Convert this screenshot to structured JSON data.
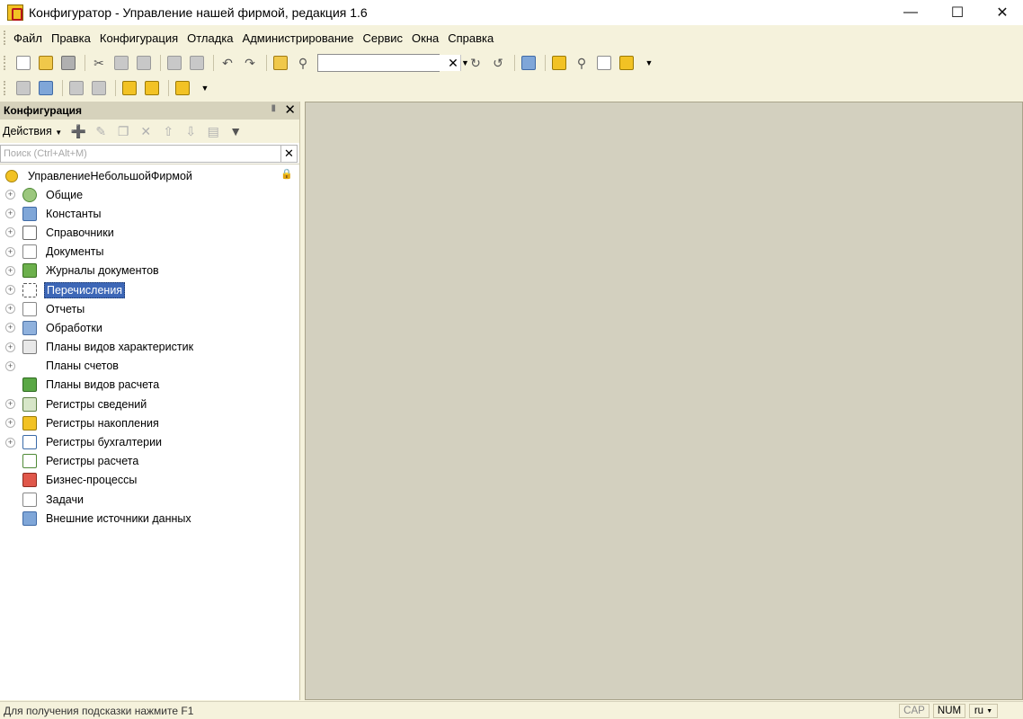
{
  "window": {
    "title": "Конфигуратор - Управление нашей фирмой, редакция 1.6"
  },
  "menu": [
    "Файл",
    "Правка",
    "Конфигурация",
    "Отладка",
    "Администрирование",
    "Сервис",
    "Окна",
    "Справка"
  ],
  "panel": {
    "title": "Конфигурация",
    "actions_label": "Действия",
    "search_placeholder": "Поиск (Ctrl+Alt+M)"
  },
  "tree": {
    "root": "УправлениеНебольшойФирмой",
    "items": [
      {
        "label": "Общие",
        "expandable": true,
        "icon": "common-icon"
      },
      {
        "label": "Константы",
        "expandable": true,
        "icon": "constants-icon"
      },
      {
        "label": "Справочники",
        "expandable": true,
        "icon": "catalogs-icon"
      },
      {
        "label": "Документы",
        "expandable": true,
        "icon": "documents-icon"
      },
      {
        "label": "Журналы документов",
        "expandable": true,
        "icon": "journals-icon"
      },
      {
        "label": "Перечисления",
        "expandable": true,
        "icon": "enums-icon",
        "selected": true
      },
      {
        "label": "Отчеты",
        "expandable": true,
        "icon": "reports-icon"
      },
      {
        "label": "Обработки",
        "expandable": true,
        "icon": "processing-icon"
      },
      {
        "label": "Планы видов характеристик",
        "expandable": true,
        "icon": "characteristic-plans-icon"
      },
      {
        "label": "Планы счетов",
        "expandable": true,
        "icon": "chart-of-accounts-icon"
      },
      {
        "label": "Планы видов расчета",
        "expandable": false,
        "icon": "calculation-plans-icon"
      },
      {
        "label": "Регистры сведений",
        "expandable": true,
        "icon": "info-registers-icon"
      },
      {
        "label": "Регистры накопления",
        "expandable": true,
        "icon": "accumulation-registers-icon"
      },
      {
        "label": "Регистры бухгалтерии",
        "expandable": true,
        "icon": "accounting-registers-icon"
      },
      {
        "label": "Регистры расчета",
        "expandable": false,
        "icon": "calculation-registers-icon"
      },
      {
        "label": "Бизнес-процессы",
        "expandable": false,
        "icon": "business-processes-icon"
      },
      {
        "label": "Задачи",
        "expandable": false,
        "icon": "tasks-icon"
      },
      {
        "label": "Внешние источники данных",
        "expandable": false,
        "icon": "external-sources-icon"
      }
    ]
  },
  "status": {
    "text": "Для получения подсказки нажмите F1",
    "cap": "CAP",
    "num": "NUM",
    "lang": "ru"
  },
  "colors": {
    "selection": "#3d67b7",
    "chrome": "#f5f2dc",
    "workspace": "#d3d0bf"
  }
}
